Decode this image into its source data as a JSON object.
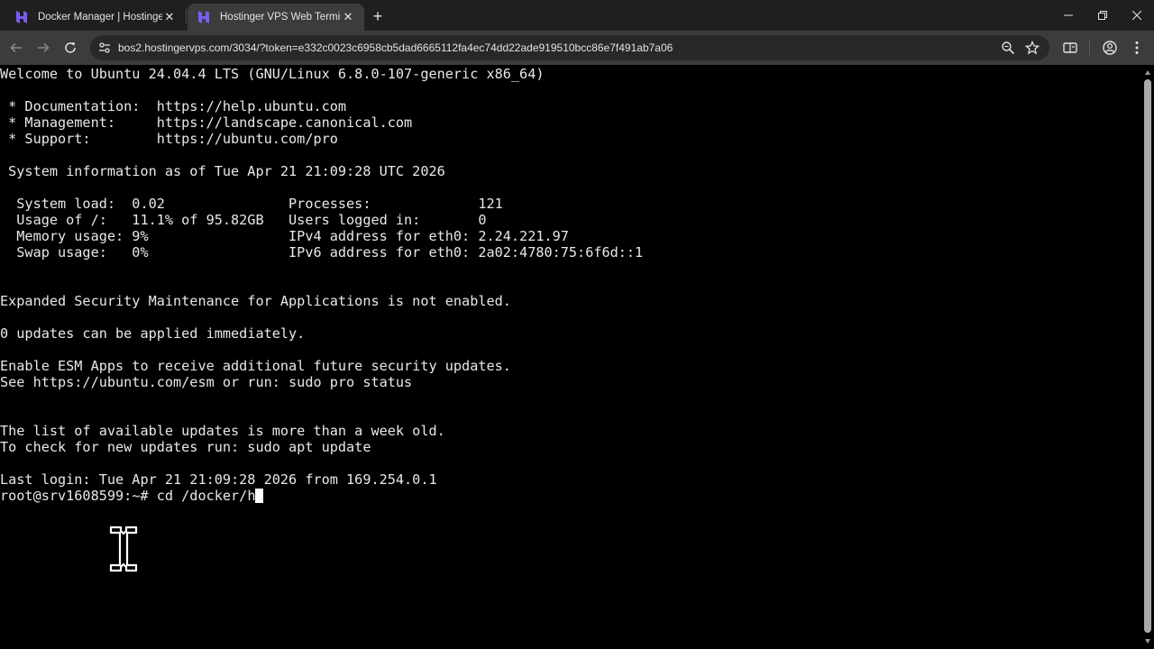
{
  "browser": {
    "tabs": [
      {
        "title": "Docker Manager | Hostinger",
        "active": false,
        "icon": "hostinger-logo-icon"
      },
      {
        "title": "Hostinger VPS Web Terminal",
        "active": true,
        "icon": "hostinger-logo-icon"
      }
    ],
    "url": "bos2.hostingervps.com/3034/?token=e332c0023c6958cb5dad6665112fa4ec74dd22ade919510bcc86e7f491ab7a06",
    "colors": {
      "tab_bg": "#1f1f1f",
      "active_tab_bg": "#3c3c3c",
      "omnibox_bg": "#282828",
      "favicon": "#7b5cf5"
    }
  },
  "terminal": {
    "lines": [
      "Welcome to Ubuntu 24.04.4 LTS (GNU/Linux 6.8.0-107-generic x86_64)",
      "",
      " * Documentation:  https://help.ubuntu.com",
      " * Management:     https://landscape.canonical.com",
      " * Support:        https://ubuntu.com/pro",
      "",
      " System information as of Tue Apr 21 21:09:28 UTC 2026",
      "",
      "  System load:  0.02               Processes:             121",
      "  Usage of /:   11.1% of 95.82GB   Users logged in:       0",
      "  Memory usage: 9%                 IPv4 address for eth0: 2.24.221.97",
      "  Swap usage:   0%                 IPv6 address for eth0: 2a02:4780:75:6f6d::1",
      "",
      "",
      "Expanded Security Maintenance for Applications is not enabled.",
      "",
      "0 updates can be applied immediately.",
      "",
      "Enable ESM Apps to receive additional future security updates.",
      "See https://ubuntu.com/esm or run: sudo pro status",
      "",
      "",
      "The list of available updates is more than a week old.",
      "To check for new updates run: sudo apt update",
      "",
      "Last login: Tue Apr 21 21:09:28 2026 from 169.254.0.1"
    ],
    "prompt": "root@srv1608599:~# ",
    "input": "cd /docker/h",
    "colors": {
      "bg": "#000000",
      "fg": "#e8e8e8",
      "cursor": "#ffffff"
    }
  }
}
